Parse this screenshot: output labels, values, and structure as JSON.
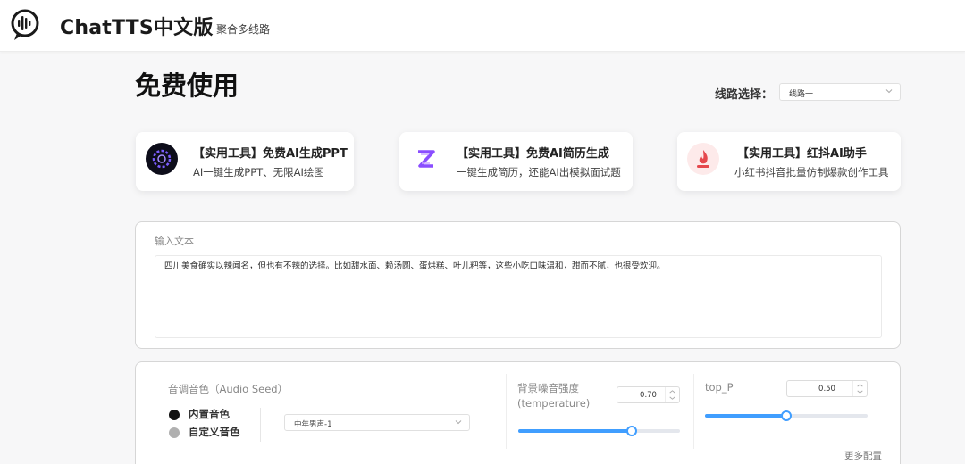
{
  "header": {
    "brand": "ChatTTS中文版",
    "subtitle": "聚合多线路"
  },
  "page": {
    "title": "免费使用",
    "route_label": "线路选择：",
    "route_value": "线路一"
  },
  "cards": [
    {
      "icon": "ppt-spark-icon",
      "title": "【实用工具】免费AI生成PPT",
      "desc": "AI一键生成PPT、无限AI绘图"
    },
    {
      "icon": "resume-z-icon",
      "title": "【实用工具】免费AI简历生成",
      "desc": "一键生成简历，还能AI出模拟面试题"
    },
    {
      "icon": "redbook-flame-icon",
      "title": "【实用工具】红抖AI助手",
      "desc": "小红书抖音批量仿制爆款创作工具"
    }
  ],
  "input": {
    "label": "输入文本",
    "text": "四川美食确实以辣闻名，但也有不辣的选择。比如甜水面、赖汤圆、蛋烘糕、叶儿粑等，这些小吃口味温和，甜而不腻，也很受欢迎。"
  },
  "settings": {
    "seed_label": "音调音色（Audio Seed）",
    "radio_builtin": "内置音色",
    "radio_custom": "自定义音色",
    "voice_value": "中年男声-1",
    "temp_label": "背景噪音强度(temperature)",
    "temp_value": "0.70",
    "temp_fraction": 0.7,
    "topp_label": "top_P",
    "topp_value": "0.50",
    "topp_fraction": 0.5,
    "more_config": "更多配置"
  },
  "colors": {
    "accent": "#409eff",
    "radio_selected": "#111111",
    "radio_unselected": "#b0b0b0"
  }
}
